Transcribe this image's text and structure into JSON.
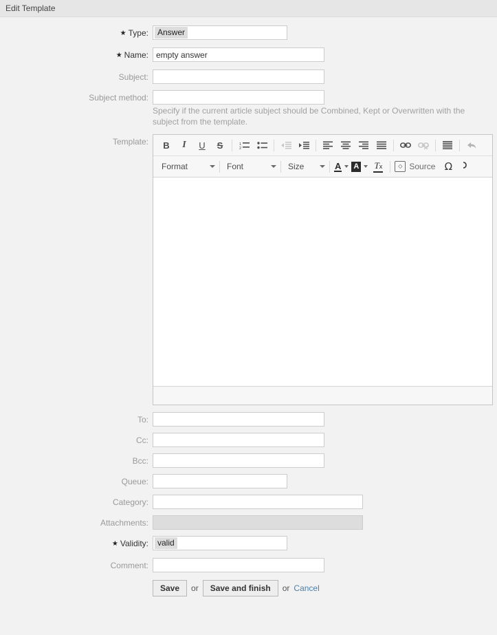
{
  "window": {
    "title": "Edit Template"
  },
  "form": {
    "fields": {
      "type": {
        "label": "Type:",
        "required": true,
        "value": "Answer"
      },
      "name": {
        "label": "Name:",
        "required": true,
        "value": "empty answer",
        "placeholder": ""
      },
      "subject": {
        "label": "Subject:",
        "required": false,
        "value": "",
        "placeholder": ""
      },
      "subject_method": {
        "label": "Subject method:",
        "required": false,
        "value": "",
        "placeholder": "",
        "help": "Specify if the current article subject should be Combined, Kept or Overwritten with the subject from the template."
      },
      "template": {
        "label": "Template:",
        "required": false,
        "value": ""
      },
      "to": {
        "label": "To:",
        "required": false,
        "value": "",
        "placeholder": ""
      },
      "cc": {
        "label": "Cc:",
        "required": false,
        "value": "",
        "placeholder": ""
      },
      "bcc": {
        "label": "Bcc:",
        "required": false,
        "value": "",
        "placeholder": ""
      },
      "queue": {
        "label": "Queue:",
        "required": false,
        "value": "",
        "placeholder": ""
      },
      "category": {
        "label": "Category:",
        "required": false,
        "value": "",
        "placeholder": ""
      },
      "attachments": {
        "label": "Attachments:",
        "required": false,
        "value": "",
        "disabled": true
      },
      "validity": {
        "label": "Validity:",
        "required": true,
        "value": "valid"
      },
      "comment": {
        "label": "Comment:",
        "required": false,
        "value": "",
        "placeholder": ""
      }
    },
    "required_marker": "★"
  },
  "editor": {
    "toolbar_row1": [
      {
        "name": "bold-icon",
        "label": "B",
        "enabled": true
      },
      {
        "name": "italic-icon",
        "label": "I",
        "enabled": true
      },
      {
        "name": "underline-icon",
        "label": "U",
        "enabled": true
      },
      {
        "name": "strikethrough-icon",
        "label": "S",
        "enabled": true
      },
      {
        "name": "numbered-list-icon",
        "label": "",
        "enabled": true
      },
      {
        "name": "bulleted-list-icon",
        "label": "",
        "enabled": true
      },
      {
        "name": "decrease-indent-icon",
        "label": "",
        "enabled": false
      },
      {
        "name": "increase-indent-icon",
        "label": "",
        "enabled": true
      },
      {
        "name": "align-left-icon",
        "label": "",
        "enabled": true
      },
      {
        "name": "align-center-icon",
        "label": "",
        "enabled": true
      },
      {
        "name": "align-right-icon",
        "label": "",
        "enabled": true
      },
      {
        "name": "align-justify-icon",
        "label": "",
        "enabled": true
      },
      {
        "name": "link-icon",
        "label": "",
        "enabled": true
      },
      {
        "name": "unlink-icon",
        "label": "",
        "enabled": false
      },
      {
        "name": "blockquote-icon",
        "label": "",
        "enabled": true
      },
      {
        "name": "undo-icon",
        "label": "",
        "enabled": true
      }
    ],
    "toolbar_row2": {
      "format_label": "Format",
      "font_label": "Font",
      "size_label": "Size",
      "text_color_glyph": "A",
      "bg_color_glyph": "A",
      "remove_format_glyph": "T",
      "remove_format_sub": "x",
      "source_label": "Source",
      "source_icon_glyph": "◇",
      "special_char_glyph": "Ω"
    },
    "content": ""
  },
  "actions": {
    "save_label": "Save",
    "or_label_1": "or",
    "save_and_finish_label": "Save and finish",
    "or_label_2": "or",
    "cancel_label": "Cancel"
  },
  "colors": {
    "titlebar_bg": "#e6e6e6",
    "page_bg": "#f2f2f2",
    "link": "#4d7ea8",
    "label": "#999999",
    "token_bg": "#dddddd",
    "disabled_bg": "#dddddd"
  }
}
